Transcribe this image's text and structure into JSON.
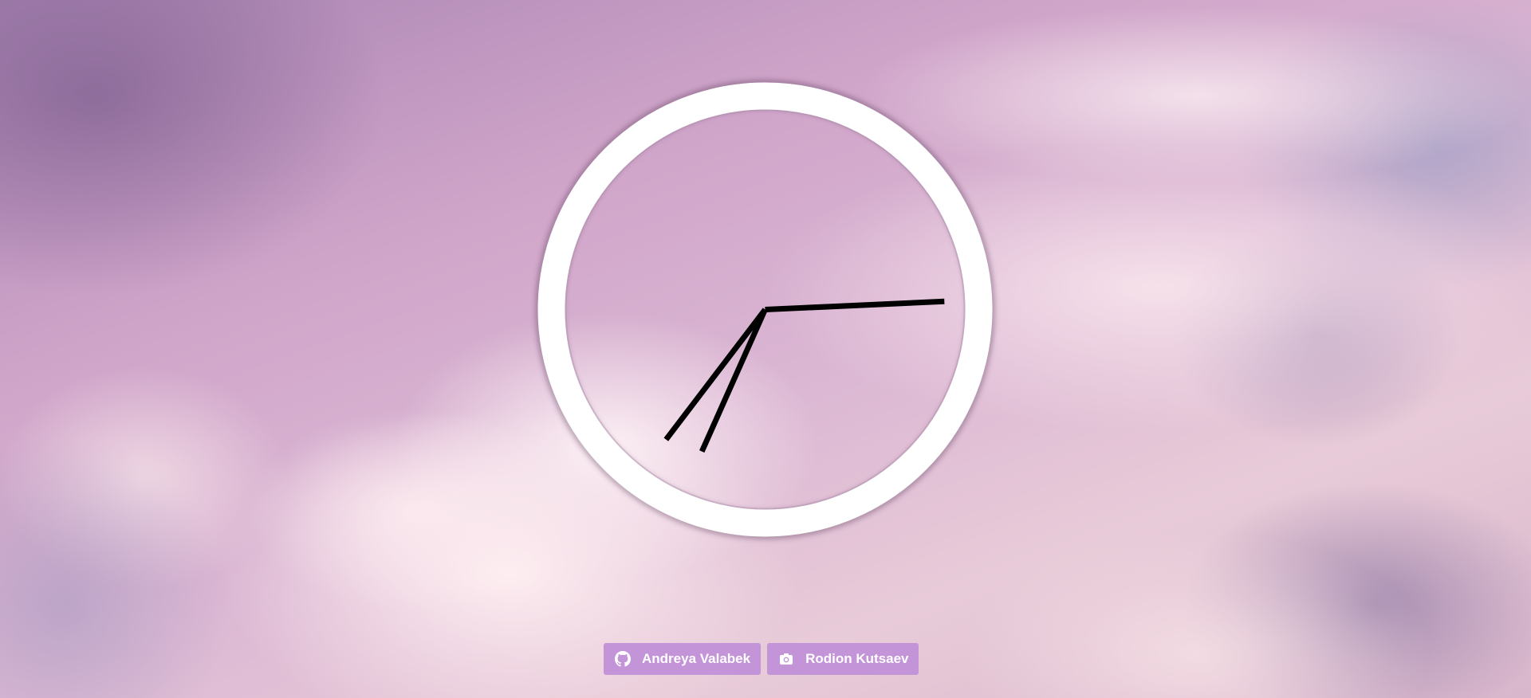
{
  "clock": {
    "time": {
      "hours": 7,
      "minutes": 14,
      "seconds": 34
    }
  },
  "credits": [
    {
      "label": "Andreya Valabek",
      "icon": "github-icon"
    },
    {
      "label": "Rodion Kutsaev",
      "icon": "camera-icon"
    }
  ],
  "colors": {
    "ring": "#ffffff",
    "hands": "#000000",
    "credit_bg": "#c494d8",
    "credit_text": "#ffffff"
  }
}
